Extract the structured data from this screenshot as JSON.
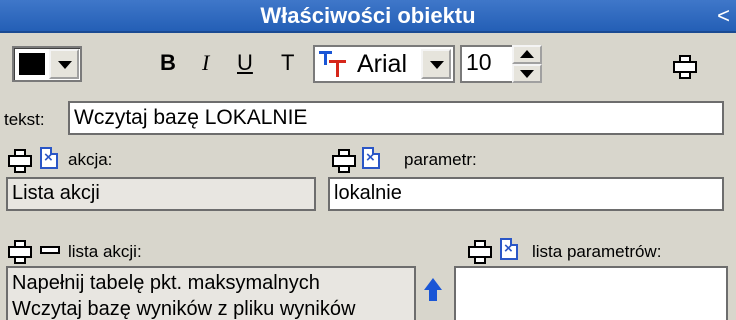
{
  "window": {
    "title": "Właściwości obiektu",
    "collapse_glyph": "<"
  },
  "toolbar": {
    "color_value": "#000000",
    "bold_label": "B",
    "italic_label": "I",
    "underline_label": "U",
    "plain_label": "T",
    "font_name": "Arial",
    "font_size": "10"
  },
  "text_field": {
    "label": "tekst:",
    "value": "Wczytaj bazę LOKALNIE"
  },
  "action": {
    "label": "akcja:",
    "value": "Lista akcji"
  },
  "parameter": {
    "label": "parametr:",
    "value": "lokalnie"
  },
  "action_list": {
    "label": "lista akcji:",
    "items": [
      "Napełnij tabelę pkt. maksymalnych",
      "Wczytaj bazę wyników z pliku wyników"
    ]
  },
  "param_list": {
    "label": "lista parametrów:",
    "items": []
  },
  "icons": {
    "add": "plus-icon",
    "remove": "minus-icon",
    "delete": "x-icon",
    "move_up": "arrow-up-icon",
    "font_type": "font-type-icon"
  },
  "colors": {
    "titlebar": "#2f69c0",
    "background": "#d8d6cc",
    "accent": "#1a56d6"
  }
}
